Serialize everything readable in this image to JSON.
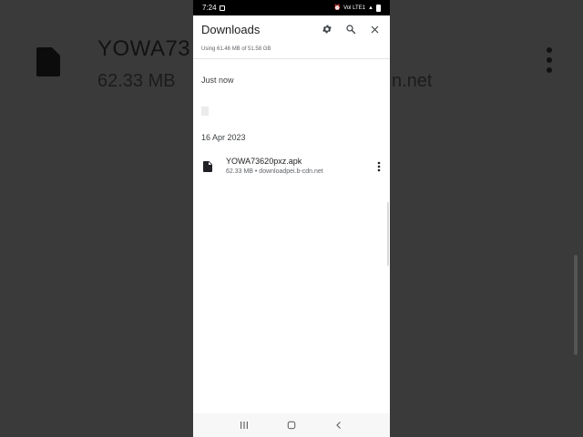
{
  "status_bar": {
    "time": "7:24",
    "signal_text": "Vol LTE1"
  },
  "app_bar": {
    "title": "Downloads"
  },
  "storage": {
    "text": "Using 61.46 MB of 51.58 GB"
  },
  "sections": [
    {
      "header": "Just now"
    },
    {
      "header": "16 Apr 2023"
    }
  ],
  "files": [
    {
      "name": "YOWA73620pxz.apk",
      "meta": "62.33 MB • downloadpei.b-cdn.net"
    }
  ],
  "background": {
    "title": "YOWA73",
    "sub": "62.33 MB",
    "sub_right": "n.net"
  },
  "colors": {
    "surface": "#ffffff",
    "text_primary": "#202124",
    "text_secondary": "#5f6368",
    "backdrop": "#3a3a3a"
  }
}
